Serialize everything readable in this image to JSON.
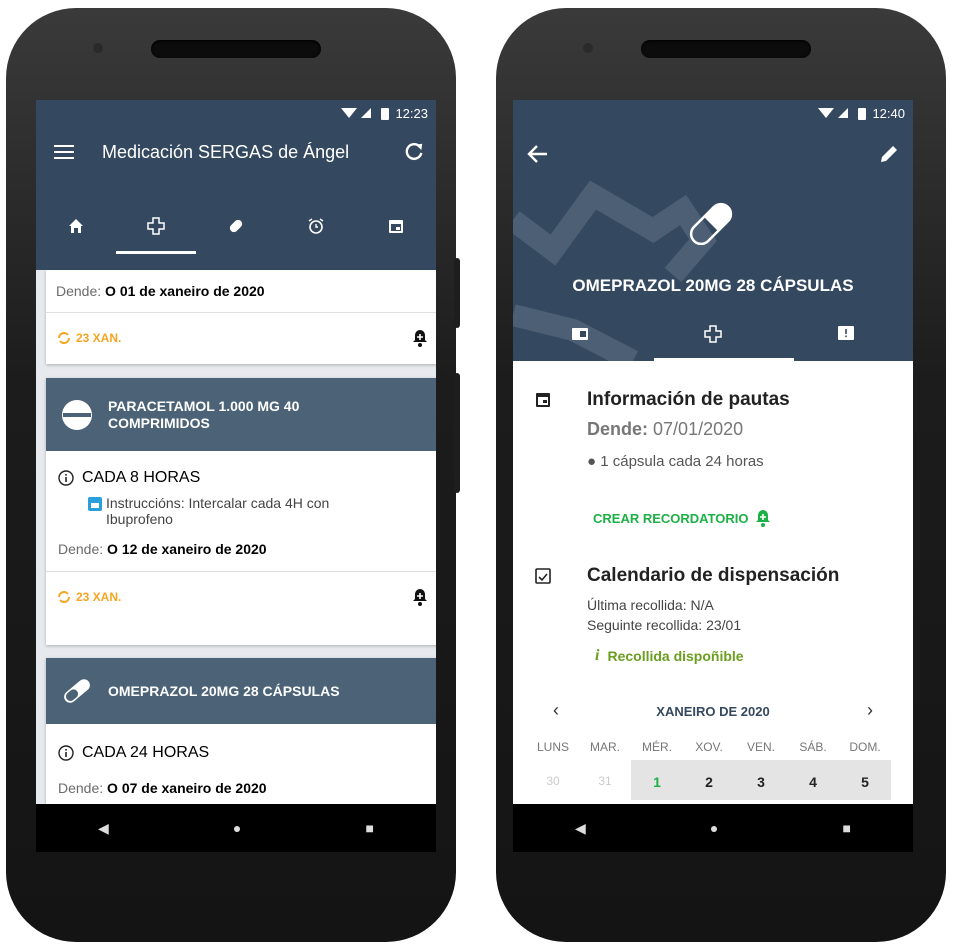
{
  "left": {
    "status_time": "12:23",
    "title": "Medicación SERGAS de Ángel",
    "tabs": [
      {
        "icon": "home-icon"
      },
      {
        "icon": "medical-cross-icon"
      },
      {
        "icon": "pill-icon"
      },
      {
        "icon": "alarm-icon"
      },
      {
        "icon": "calendar-icon"
      }
    ],
    "card1": {
      "since_label": "Dende:",
      "since_value": "O 01 de xaneiro de 2020",
      "renew": "23 XAN."
    },
    "card2": {
      "name": "PARACETAMOL 1.000 MG 40 COMPRIMIDOS",
      "frequency": "CADA 8 HORAS",
      "instructions": "Instruccións: Intercalar cada 4H con Ibuprofeno",
      "since_label": "Dende:",
      "since_value": "O 12 de xaneiro de 2020",
      "renew": "23 XAN."
    },
    "card3": {
      "name": "OMEPRAZOL 20MG 28 CÁPSULAS",
      "frequency": "CADA 24 HORAS",
      "since_label": "Dende:",
      "since_value": "O 07 de xaneiro de 2020"
    }
  },
  "right": {
    "status_time": "12:40",
    "drug_name": "OMEPRAZOL 20MG 28 CÁPSULAS",
    "section1": {
      "title": "Información de pautas",
      "since_label": "Dende:",
      "since_value": "07/01/2020",
      "dose": "1 cápsula cada 24 horas",
      "reminder_button": "CREAR RECORDATORIO"
    },
    "section2": {
      "title": "Calendario de dispensación",
      "last_pickup": "Última recollida: N/A",
      "next_pickup": "Seguinte recollida: 23/01",
      "available": "Recollida dispoñible"
    },
    "calendar": {
      "month": "XANEIRO DE 2020",
      "weekdays": [
        "LUNS",
        "MAR.",
        "MÉR.",
        "XOV.",
        "VEN.",
        "SÁB.",
        "DOM."
      ],
      "days": [
        "30",
        "31",
        "1",
        "2",
        "3",
        "4",
        "5"
      ]
    }
  },
  "colors": {
    "appbar": "#34495f",
    "card_head": "#4b6277",
    "accent_green": "#1db046",
    "accent_orange": "#f5a623"
  }
}
